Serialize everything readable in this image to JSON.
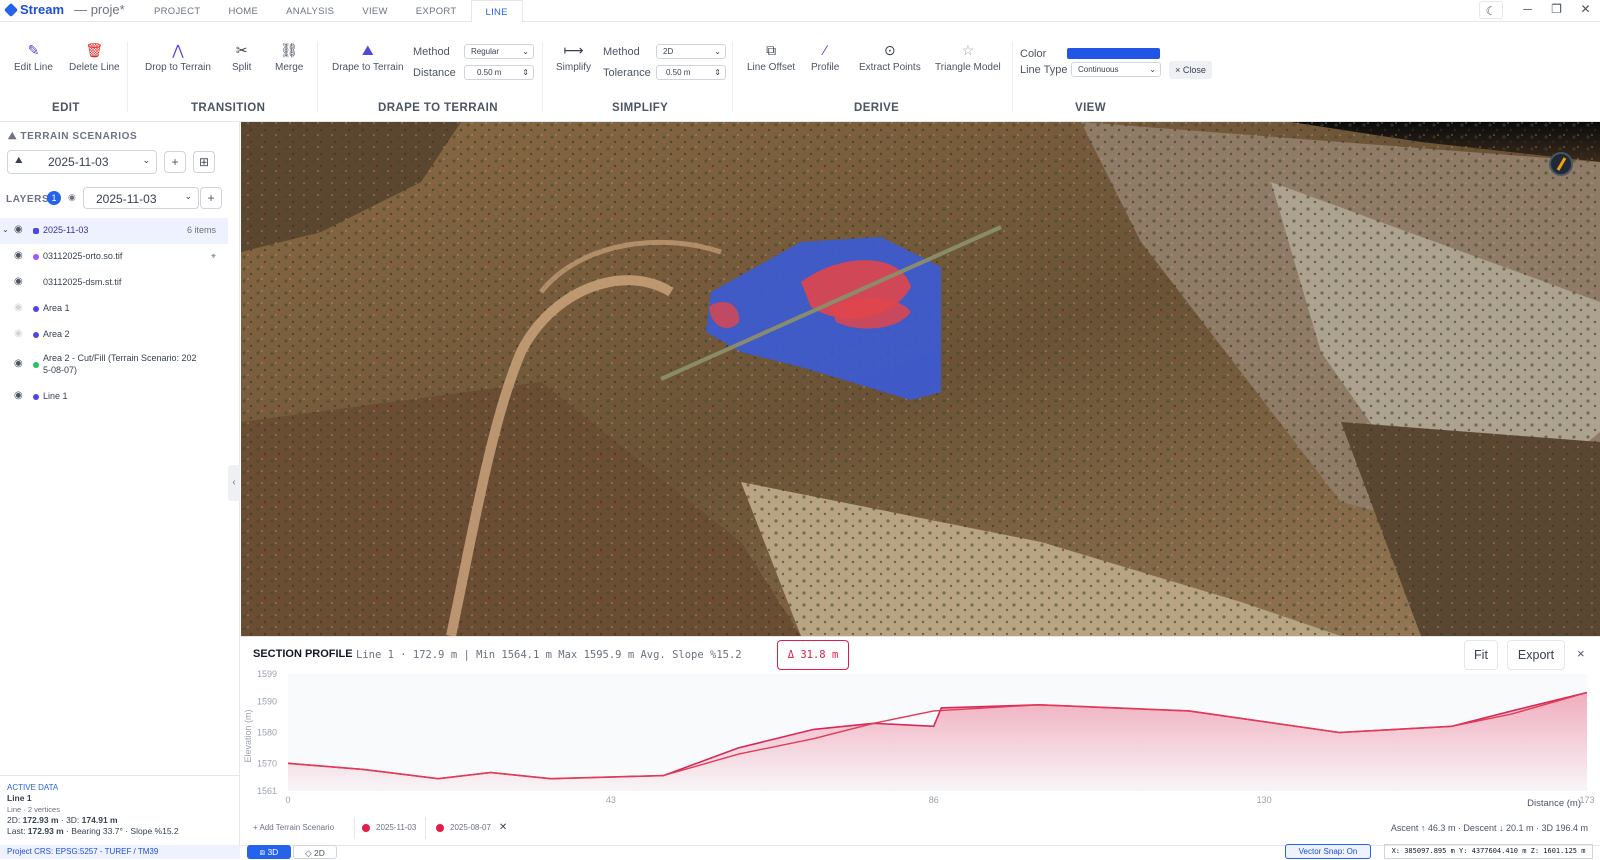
{
  "app": {
    "name": "Stream",
    "project": "— proje*"
  },
  "menu_tabs": [
    "PROJECT",
    "HOME",
    "ANALYSIS",
    "VIEW",
    "EXPORT",
    "LINE"
  ],
  "active_tab": "LINE",
  "ribbon": {
    "edit_line": "Edit Line",
    "delete_line": "Delete Line",
    "drop_to_terrain": "Drop to Terrain",
    "split": "Split",
    "merge": "Merge",
    "drape_to_terrain": "Drape to Terrain",
    "method_label": "Method",
    "method_value": "Regular",
    "distance_label": "Distance",
    "distance_value": "0.50 m",
    "simplify": "Simplify",
    "simplify_method_label": "Method",
    "simplify_method_value": "2D",
    "tolerance_label": "Tolerance",
    "tolerance_value": "0.50 m",
    "line_offset": "Line Offset",
    "profile": "Profile",
    "extract_points": "Extract Points",
    "triangle_model": "Triangle Model",
    "color_label": "Color",
    "line_color": "#2155e6",
    "line_type_label": "Line Type",
    "line_type_value": "Continuous",
    "close": "× Close",
    "groups": {
      "edit": "EDIT",
      "transition": "TRANSITION",
      "drape": "DRAPE TO TERRAIN",
      "simplify": "SIMPLIFY",
      "derive": "DERIVE",
      "view": "VIEW"
    }
  },
  "sidebar": {
    "terrain_title": "TERRAIN SCENARIOS",
    "terrain_value": "2025-11-03",
    "layers_title": "LAYERS",
    "layers_badge": "1",
    "layers_value": "2025-11-03",
    "layers": [
      {
        "name": "2025-11-03",
        "count": "6 items",
        "color": "#4f46e5",
        "visible": true
      },
      {
        "name": "03112025-orto.so.tif",
        "color": "#a855f7",
        "visible": true
      },
      {
        "name": "03112025-dsm.st.tif",
        "color": "",
        "visible": true
      },
      {
        "name": "Area 1",
        "color": "#4f46e5",
        "visible": false
      },
      {
        "name": "Area 2",
        "color": "#4f46e5",
        "visible": false
      },
      {
        "name": "Area 2 - Cut/Fill (Terrain Scenario: 202",
        "name2": "5-08-07)",
        "color": "#22c55e",
        "visible": true
      },
      {
        "name": "Line 1",
        "color": "#4f46e5",
        "visible": true
      }
    ],
    "active_data": {
      "title": "ACTIVE DATA",
      "name": "Line 1",
      "sub": "Line · 2 vertices",
      "l1_pre": "2D: ",
      "l1_2d": "172.93 m",
      "l1_mid": " · 3D: ",
      "l1_3d": "174.91 m",
      "l2_pre": "Last: ",
      "l2_last": "172.93 m",
      "l2_post": " · Bearing 33.7° · Slope %15.2"
    },
    "crs": "Project CRS: EPSG:5257 - TUREF / TM39"
  },
  "section": {
    "title": "SECTION PROFILE",
    "stats": "Line 1 · 172.9 m | Min 1564.1 m Max 1595.9 m Avg. Slope %15.2",
    "delta": "Δ 31.8 m",
    "fit": "Fit",
    "export": "Export",
    "close": "×",
    "add_scenario": "+ Add Terrain Scenario",
    "scenarios": [
      {
        "label": "2025-11-03",
        "color": "#e11d48"
      },
      {
        "label": "2025-08-07",
        "color": "#e11d48"
      }
    ],
    "footer": "Ascent ↑ 46.3 m · Descent ↓ 20.1 m · 3D 196.4 m"
  },
  "chart_data": {
    "type": "area",
    "xlabel": "Distance (m)",
    "ylabel": "Elevation (m)",
    "xlim": [
      0,
      173
    ],
    "ylim": [
      1561,
      1599
    ],
    "x_ticks": [
      "0",
      "43",
      "86",
      "130",
      "173"
    ],
    "y_ticks": [
      "1599",
      "1590",
      "1580",
      "1570",
      "1561"
    ],
    "series": [
      {
        "name": "2025-11-03",
        "x": [
          0,
          10,
          20,
          27,
          35,
          50,
          60,
          70,
          78,
          86,
          87,
          100,
          120,
          140,
          155,
          163,
          173
        ],
        "y": [
          1570,
          1568,
          1565,
          1567,
          1565,
          1566,
          1575,
          1581,
          1583,
          1582,
          1588,
          1589,
          1587,
          1580,
          1582,
          1587,
          1593
        ]
      },
      {
        "name": "2025-08-07",
        "x": [
          0,
          10,
          20,
          27,
          35,
          50,
          60,
          70,
          78,
          86,
          100,
          120,
          140,
          155,
          163,
          173
        ],
        "y": [
          1570,
          1568,
          1565,
          1567,
          1565,
          1566,
          1573,
          1578,
          1583,
          1587,
          1589,
          1587,
          1580,
          1582,
          1586,
          1593
        ]
      }
    ]
  },
  "view_toggle": {
    "three_d": "3D",
    "two_d": "2D"
  },
  "status": {
    "snap": "Vector Snap: On",
    "coords": "X: 385097.895 m Y: 4377604.410 m Z: 1601.125 m"
  }
}
